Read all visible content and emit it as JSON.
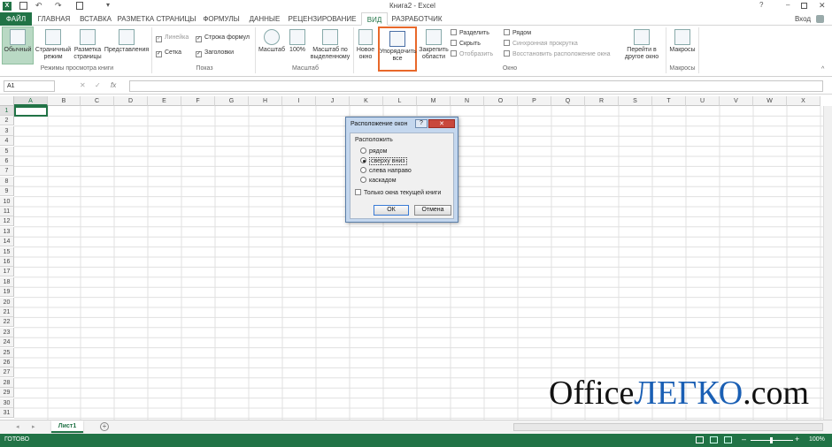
{
  "window": {
    "title": "Книга2 - Excel",
    "signin": "Вход"
  },
  "tabs": [
    "ФАЙЛ",
    "ГЛАВНАЯ",
    "ВСТАВКА",
    "РАЗМЕТКА СТРАНИЦЫ",
    "ФОРМУЛЫ",
    "ДАННЫЕ",
    "РЕЦЕНЗИРОВАНИЕ",
    "ВИД",
    "РАЗРАБОТЧИК"
  ],
  "ribbon": {
    "views": {
      "normal": "Обычный",
      "pagebreak": "Страничный режим",
      "pagelayout": "Разметка страницы",
      "custom": "Представления",
      "label": "Режимы просмотра книги"
    },
    "show": {
      "ruler": "Линейка",
      "formulabar": "Строка формул",
      "grid": "Сетка",
      "headings": "Заголовки",
      "label": "Показ"
    },
    "zoom": {
      "zoom": "Масштаб",
      "hundred": "100%",
      "selection": "Масштаб по выделенному",
      "label": "Масштаб"
    },
    "window": {
      "newwin": "Новое окно",
      "arrange": "Упорядочить все",
      "freeze": "Закрепить области",
      "split": "Разделить",
      "hide": "Скрыть",
      "unhide": "Отобразить",
      "side": "Рядом",
      "sync": "Синхронная прокрутка",
      "reset": "Восстановить расположение окна",
      "switch": "Перейти в другое окно",
      "label": "Окно"
    },
    "macros": {
      "macros": "Макросы",
      "label": "Макросы"
    }
  },
  "formula": {
    "namebox": "A1",
    "fx": "fx"
  },
  "columns": [
    "A",
    "B",
    "C",
    "D",
    "E",
    "F",
    "G",
    "H",
    "I",
    "J",
    "K",
    "L",
    "M",
    "N",
    "O",
    "P",
    "Q",
    "R",
    "S",
    "T",
    "U",
    "V",
    "W",
    "X"
  ],
  "rows": [
    "1",
    "2",
    "3",
    "4",
    "5",
    "6",
    "7",
    "8",
    "9",
    "10",
    "11",
    "12",
    "13",
    "14",
    "15",
    "16",
    "17",
    "18",
    "19",
    "20",
    "21",
    "22",
    "23",
    "24",
    "25",
    "26",
    "27",
    "28",
    "29",
    "30",
    "31"
  ],
  "sheet": {
    "tab": "Лист1"
  },
  "status": {
    "ready": "ГОТОВО",
    "zoom": "100%"
  },
  "dialog": {
    "title": "Расположение окон",
    "group": "Расположить",
    "options": [
      "рядом",
      "сверху вниз",
      "слева направо",
      "каскадом"
    ],
    "selected_index": 1,
    "checkbox": "Только окна текущей книги",
    "ok": "ОК",
    "cancel": "Отмена"
  },
  "watermark": {
    "part1": "Office",
    "part2": "ЛЕГКО",
    "part3": ".com"
  },
  "colors": {
    "accent": "#217346",
    "highlight": "#e8682a"
  }
}
